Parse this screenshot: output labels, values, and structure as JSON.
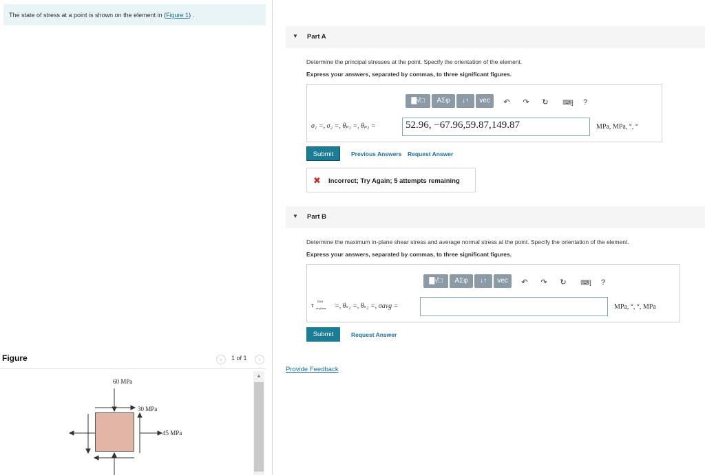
{
  "intro": {
    "text": "The state of stress at a point is shown on the element in (",
    "link": "Figure 1",
    "suffix": ") ."
  },
  "figure": {
    "title": "Figure",
    "pager": "1 of 1",
    "prev_icon": "chevron-left-icon",
    "next_icon": "chevron-right-icon",
    "labels": {
      "top": "60 MPa",
      "shear": "30 MPa",
      "right": "45 MPa"
    },
    "element_color": "#e3b5a7"
  },
  "part_a": {
    "arrow": "▼",
    "title": "Part A",
    "question": "Determine the principal stresses at the point. Specify the orientation of the element.",
    "instruction": "Express your answers, separated by commas, to three significant figures.",
    "toolbar": {
      "templates": "▇√□",
      "symbols": "ΑΣφ",
      "arrows": "↓↑",
      "vec": "vec",
      "undo": "↶",
      "redo": "↷",
      "reset": "↻",
      "keyboard": "⌨]",
      "help": "?"
    },
    "label": "σ₁ =, σ₂ =, θₚ₁ =, θₚ₂ =",
    "value": "52.96, −67.96,59.87,149.87",
    "units": "MPa, MPa, °, °",
    "submit": "Submit",
    "previous_answers": "Previous Answers",
    "request_answer": "Request Answer",
    "feedback_icon": "✖",
    "feedback": "Incorrect; Try Again; 5 attempts remaining"
  },
  "part_b": {
    "arrow": "▼",
    "title": "Part B",
    "question": "Determine the maximum in-plane shear stress and average normal stress at the point. Specify the orientation of the element.",
    "instruction": "Express your answers, separated by commas, to three significant figures.",
    "toolbar": {
      "templates": "▇√□",
      "symbols": "ΑΣφ",
      "arrows": "↓↑",
      "vec": "vec",
      "undo": "↶",
      "redo": "↷",
      "reset": "↻",
      "keyboard": "⌨]",
      "help": "?"
    },
    "label_tau": "τ",
    "label_sub_top": "max",
    "label_sub_bottom": "in-plane",
    "label_rest": "=, θₛ₁ =, θₛ₂ =, σavg =",
    "value": "",
    "units": "MPa, °, °, MPa",
    "submit": "Submit",
    "request_answer": "Request Answer"
  },
  "provide_feedback": "Provide Feedback",
  "colors": {
    "accent": "#1b7c96",
    "link": "#1a6fa0",
    "error": "#c9302c",
    "toolbar": "#8b9aa6"
  }
}
